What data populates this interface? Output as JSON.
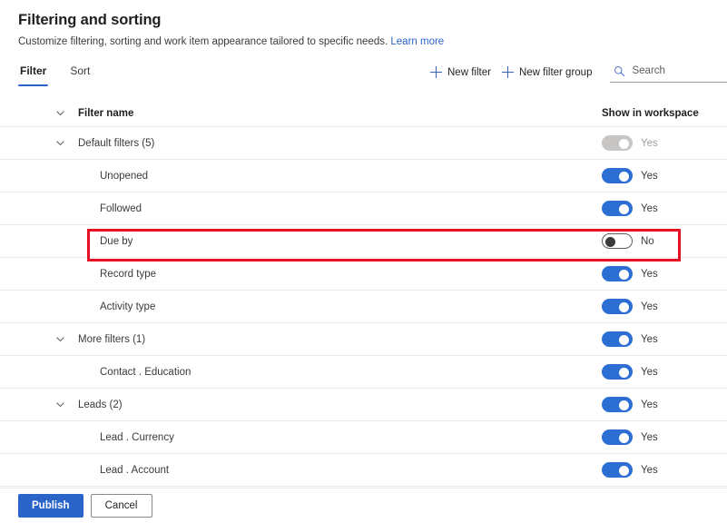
{
  "header": {
    "title": "Filtering and sorting",
    "subtitle": "Customize filtering, sorting and work item appearance tailored to specific needs.",
    "learn_more": "Learn more"
  },
  "tabs": [
    {
      "label": "Filter",
      "active": true
    },
    {
      "label": "Sort",
      "active": false
    }
  ],
  "commands": {
    "new_filter": "New filter",
    "new_filter_group": "New filter group"
  },
  "search": {
    "placeholder": "Search",
    "value": ""
  },
  "table": {
    "columns": {
      "filter_name": "Filter name",
      "show_in_workspace": "Show in workspace"
    },
    "rows": [
      {
        "name": "Default filters (5)",
        "level": 0,
        "expandable": true,
        "toggle_state": "disabled-on",
        "toggle_label": "Yes",
        "highlighted": false
      },
      {
        "name": "Unopened",
        "level": 1,
        "expandable": false,
        "toggle_state": "on",
        "toggle_label": "Yes",
        "highlighted": false
      },
      {
        "name": "Followed",
        "level": 1,
        "expandable": false,
        "toggle_state": "on",
        "toggle_label": "Yes",
        "highlighted": false
      },
      {
        "name": "Due by",
        "level": 1,
        "expandable": false,
        "toggle_state": "off",
        "toggle_label": "No",
        "highlighted": true
      },
      {
        "name": "Record type",
        "level": 1,
        "expandable": false,
        "toggle_state": "on",
        "toggle_label": "Yes",
        "highlighted": false
      },
      {
        "name": "Activity type",
        "level": 1,
        "expandable": false,
        "toggle_state": "on",
        "toggle_label": "Yes",
        "highlighted": false
      },
      {
        "name": "More filters (1)",
        "level": 0,
        "expandable": true,
        "toggle_state": "on",
        "toggle_label": "Yes",
        "highlighted": false
      },
      {
        "name": "Contact . Education",
        "level": 1,
        "expandable": false,
        "toggle_state": "on",
        "toggle_label": "Yes",
        "highlighted": false
      },
      {
        "name": "Leads (2)",
        "level": 0,
        "expandable": true,
        "toggle_state": "on",
        "toggle_label": "Yes",
        "highlighted": false
      },
      {
        "name": "Lead . Currency",
        "level": 1,
        "expandable": false,
        "toggle_state": "on",
        "toggle_label": "Yes",
        "highlighted": false
      },
      {
        "name": "Lead . Account",
        "level": 1,
        "expandable": false,
        "toggle_state": "on",
        "toggle_label": "Yes",
        "highlighted": false
      }
    ]
  },
  "footer": {
    "publish": "Publish",
    "cancel": "Cancel"
  },
  "icons": {
    "chevron_down": "chevron-down-icon",
    "plus": "plus-icon",
    "search": "search-icon"
  },
  "colors": {
    "accent_blue": "#2b64c8",
    "toggle_on": "#2b6fd4",
    "highlight_red": "#e81123",
    "link_blue": "#2b64c8",
    "divider": "#edebe9"
  }
}
